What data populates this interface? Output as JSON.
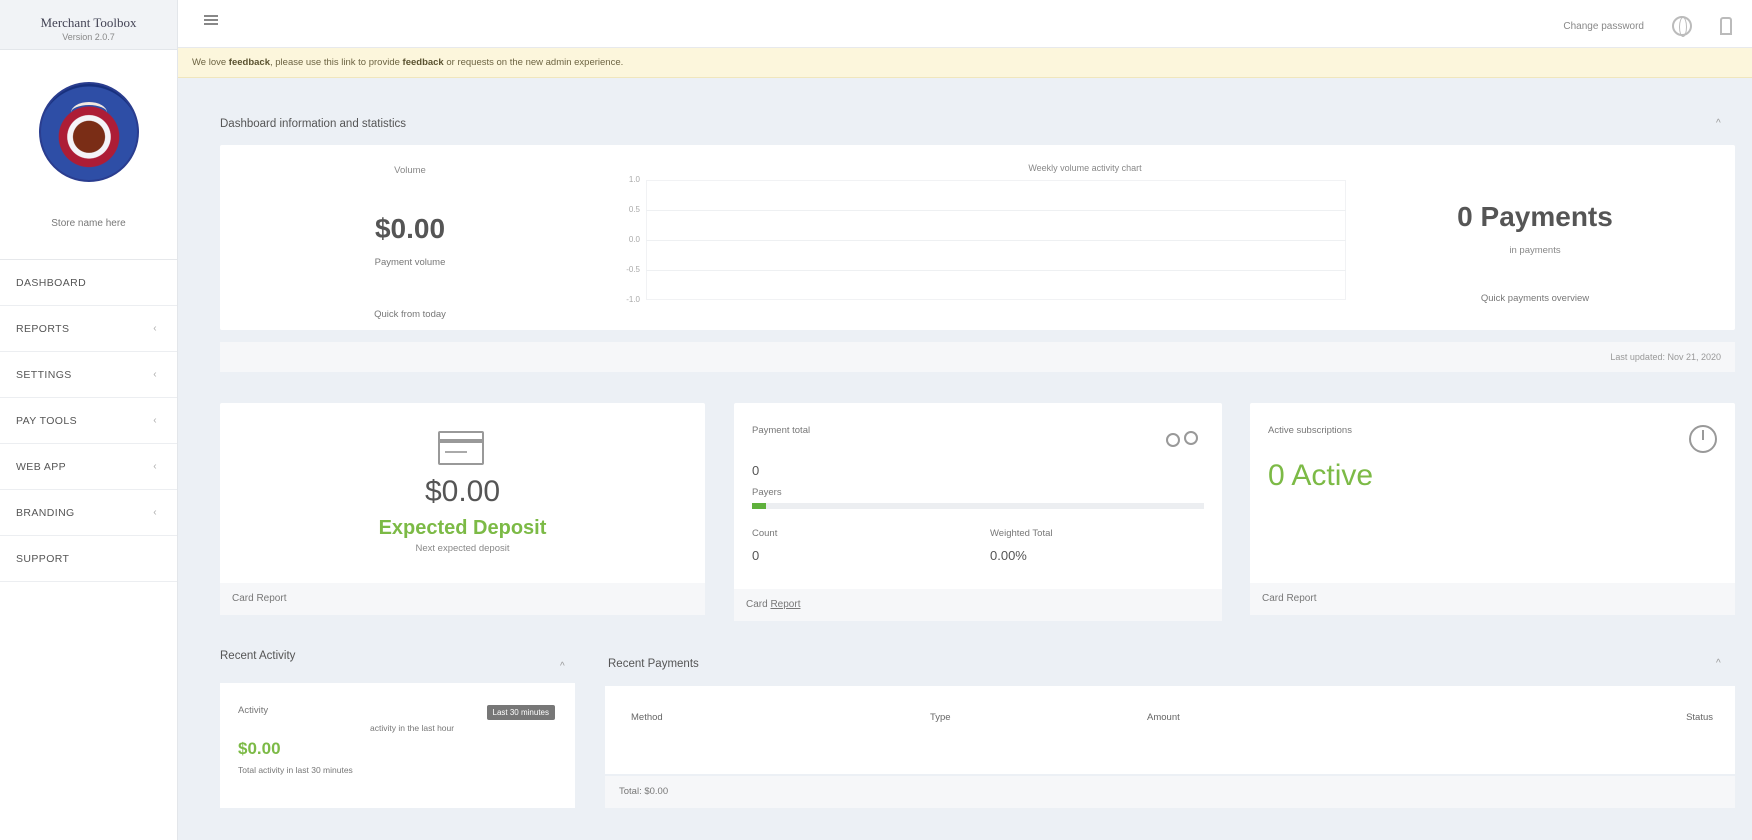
{
  "sidebar": {
    "brand_title": "Merchant Toolbox",
    "version": "Version 2.0.7",
    "store_name": "Store name here",
    "items": [
      {
        "label": "DASHBOARD",
        "chevron": ""
      },
      {
        "label": "REPORTS",
        "chevron": "‹"
      },
      {
        "label": "SETTINGS",
        "chevron": "‹"
      },
      {
        "label": "PAY TOOLS",
        "chevron": "‹"
      },
      {
        "label": "WEB APP",
        "chevron": "‹"
      },
      {
        "label": "BRANDING",
        "chevron": "‹"
      },
      {
        "label": "SUPPORT",
        "chevron": ""
      }
    ]
  },
  "topbar": {
    "user_text": "Change password"
  },
  "alert": {
    "prefix": "We love ",
    "bold1": "feedback",
    "middle": ", please use this link to provide ",
    "bold2": "feedback",
    "suffix": " or requests on the new admin experience."
  },
  "stats": {
    "title": "Dashboard information and statistics",
    "collapse": "^",
    "volume": {
      "label": "Volume",
      "value": "$0.00",
      "sublabel": "Payment volume",
      "link": "Quick from today"
    },
    "chart": {
      "title": "Weekly volume activity chart",
      "y_ticks": [
        "1.0",
        "0.5",
        "0.0",
        "-0.5",
        "-1.0"
      ]
    },
    "payments": {
      "value": "0 Payments",
      "sublabel": "in payments",
      "link": "Quick payments overview"
    },
    "footer": "Last updated: Nov 21, 2020"
  },
  "deposit": {
    "value": "$0.00",
    "label": "Expected Deposit",
    "sublabel": "Next expected deposit",
    "footer": "Card Report"
  },
  "payers": {
    "title": "Payment total",
    "count": "0",
    "count_label": "Payers",
    "progress": 0.03,
    "l1": "Count",
    "v1": "0",
    "l2": "Weighted Total",
    "v2": "0.00%",
    "footer_prefix": "Card ",
    "footer_link": "Report"
  },
  "subs": {
    "title": "Active subscriptions",
    "value": "0 Active",
    "footer": "Card Report"
  },
  "activity": {
    "title": "Recent Activity",
    "collapse": "^",
    "label": "Activity",
    "badge": "Last 30 minutes",
    "note": "activity in the last hour",
    "value": "$0.00",
    "sub": "Total activity in last 30 minutes"
  },
  "recent_payments": {
    "title": "Recent Payments",
    "collapse": "^",
    "headers": [
      "Method",
      "Type",
      "Amount",
      "Status"
    ],
    "footer": "Total: $0.00"
  }
}
